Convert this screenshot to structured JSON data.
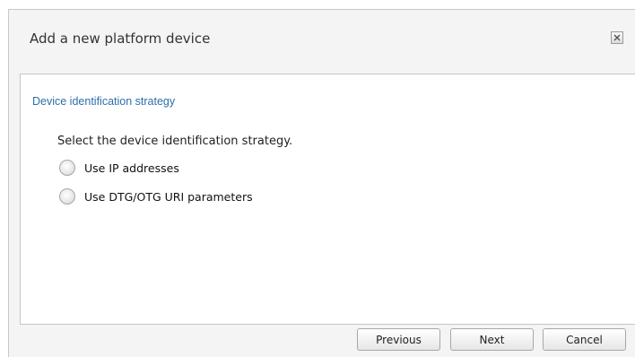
{
  "dialog": {
    "title": "Add a new platform device",
    "close_icon": "close-icon"
  },
  "section": {
    "title": "Device identification strategy",
    "instruction": "Select the device identification strategy."
  },
  "options": [
    {
      "label": "Use IP addresses",
      "selected": false
    },
    {
      "label": "Use DTG/OTG URI parameters",
      "selected": false
    }
  ],
  "footer": {
    "previous_label": "Previous",
    "next_label": "Next",
    "cancel_label": "Cancel"
  },
  "colors": {
    "section_title": "#2d6fa8",
    "dialog_bg": "#f4f4f4",
    "content_bg": "#ffffff"
  }
}
